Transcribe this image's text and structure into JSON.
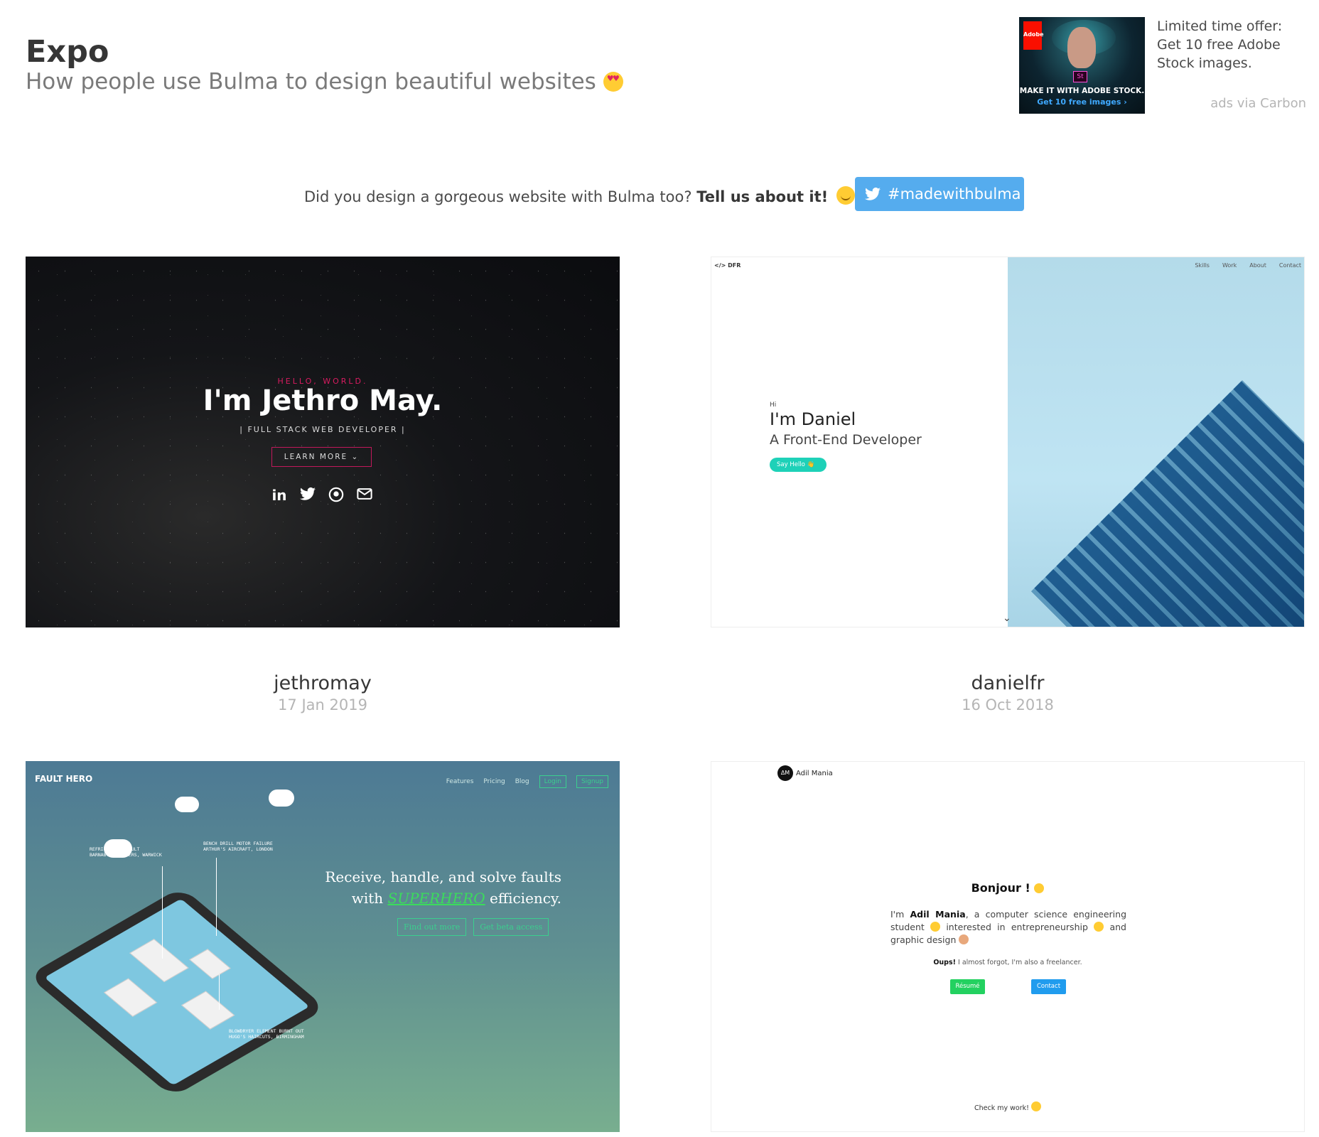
{
  "header": {
    "title": "Expo",
    "subtitle": "How people use Bulma to design beautiful websites"
  },
  "ad": {
    "image_caption_line1": "MAKE IT WITH ADOBE STOCK.",
    "image_caption_line2": "Get 10 free images ›",
    "brand_logo_text": "Adobe",
    "product_badge": "St",
    "text": "Limited time offer: Get 10 free Adobe Stock images.",
    "via": "ads via Carbon"
  },
  "cta": {
    "question": "Did you design a gorgeous website with Bulma too?",
    "bold": "Tell us about it!",
    "twitter_button": "#madewithbulma"
  },
  "showcase": [
    {
      "user": "jethromay",
      "date": "17 Jan 2019",
      "screenshot": {
        "kicker": "HELLO, WORLD.",
        "headline": "I'm Jethro May.",
        "role": "| FULL STACK WEB DEVELOPER |",
        "button": "LEARN MORE ⌄",
        "icons": [
          "linkedin-icon",
          "twitter-icon",
          "github-icon",
          "envelope-icon"
        ]
      }
    },
    {
      "user": "danielfr",
      "date": "16 Oct 2018",
      "screenshot": {
        "logo": "</> DFR",
        "nav": [
          "Skills",
          "Work",
          "About",
          "Contact"
        ],
        "greeting": "Hi",
        "headline": "I'm Daniel",
        "role": "A Front-End Developer",
        "button": "Say Hello 👋"
      }
    },
    {
      "screenshot": {
        "logo": "FAULT HERO",
        "nav": [
          "Features",
          "Pricing",
          "Blog",
          "Login",
          "Signup"
        ],
        "headline_line1": "Receive, handle, and solve faults",
        "headline_pre": "with",
        "headline_hero": "SUPERHERO",
        "headline_post": "efficiency.",
        "buttons": [
          "Find out more",
          "Get beta access"
        ],
        "notes": [
          "REFRIGERATOR FAULT\nBARNABY'S BURGERS, WARWICK",
          "BENCH DRILL MOTOR FAILURE\nARTHUR'S AIRCRAFT, LONDON",
          "BLOWDRYER ELEMENT BURNT OUT\nHUGO'S HAIRCUTS, BIRMINGHAM"
        ]
      }
    },
    {
      "screenshot": {
        "logo_mark": "ΔΜ",
        "logo": "Adil Mania",
        "greeting": "Bonjour !",
        "intro_pre": "I'm",
        "intro_name": "Adil Mania",
        "intro_rest1": ", a computer science engineering student",
        "intro_rest2": "interested in entrepreneurship",
        "intro_rest3": "and graphic design",
        "oups_bold": "Oups!",
        "oups_rest": "I almost forgot, I'm also a freelancer.",
        "resume": "Résumé",
        "contact": "Contact",
        "check": "Check my work!"
      }
    }
  ],
  "colors": {
    "twitter": "#55acee",
    "accent_pink": "#d81b60",
    "teal": "#1ed1b8",
    "bulma_green": "#23d160",
    "bulma_blue": "#209cee"
  }
}
